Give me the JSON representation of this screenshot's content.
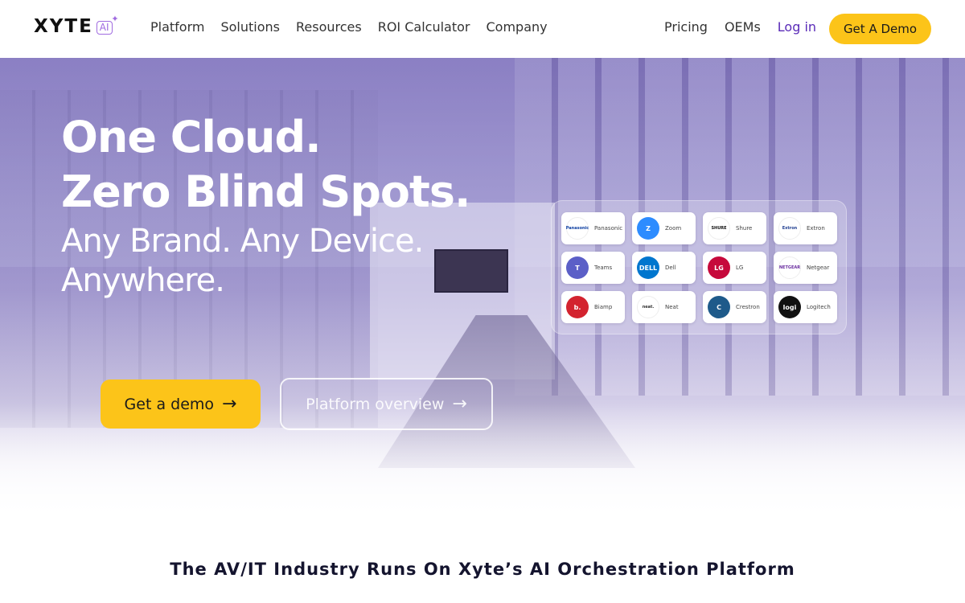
{
  "nav": {
    "logo_text": "XYTE",
    "logo_badge": "AI",
    "menu": [
      "Platform",
      "Solutions",
      "Resources",
      "ROI Calculator",
      "Company"
    ],
    "right_menu": [
      "Pricing",
      "OEMs",
      "Log in"
    ],
    "cta": "Get A Demo"
  },
  "hero": {
    "headline_1": "One Cloud.",
    "headline_2": "Zero Blind Spots.",
    "subline_1": "Any Brand. Any Device.",
    "subline_2": "Anywhere.",
    "primary_button": "Get a demo",
    "secondary_button": "Platform overview",
    "brands": [
      {
        "name": "Panasonic",
        "mark": "Panasonic",
        "color": "#ffffff",
        "text_color": "#0b3da1"
      },
      {
        "name": "Zoom",
        "mark": "Z",
        "color": "#2d8cff",
        "text_color": "#ffffff"
      },
      {
        "name": "Shure",
        "mark": "SHURE",
        "color": "#ffffff",
        "text_color": "#111111"
      },
      {
        "name": "Extron",
        "mark": "Extron",
        "color": "#ffffff",
        "text_color": "#1d3c8f"
      },
      {
        "name": "Teams",
        "mark": "T",
        "color": "#5b5fc7",
        "text_color": "#ffffff"
      },
      {
        "name": "Dell",
        "mark": "DELL",
        "color": "#0076ce",
        "text_color": "#ffffff"
      },
      {
        "name": "LG",
        "mark": "LG",
        "color": "#c6093b",
        "text_color": "#ffffff"
      },
      {
        "name": "Netgear",
        "mark": "NETGEAR",
        "color": "#ffffff",
        "text_color": "#6b2fa0"
      },
      {
        "name": "Biamp",
        "mark": "b.",
        "color": "#d3232f",
        "text_color": "#ffffff"
      },
      {
        "name": "Neat",
        "mark": "neat.",
        "color": "#ffffff",
        "text_color": "#333333"
      },
      {
        "name": "Crestron",
        "mark": "C",
        "color": "#1e5a8a",
        "text_color": "#ffffff"
      },
      {
        "name": "Logitech",
        "mark": "logi",
        "color": "#111111",
        "text_color": "#ffffff"
      }
    ]
  },
  "tagline": "The AV/IT Industry Runs On Xyte’s AI Orchestration Platform",
  "colors": {
    "accent_yellow": "#fcc419",
    "login_purple": "#5a2bb8",
    "hero_purple": "#7868b8"
  }
}
